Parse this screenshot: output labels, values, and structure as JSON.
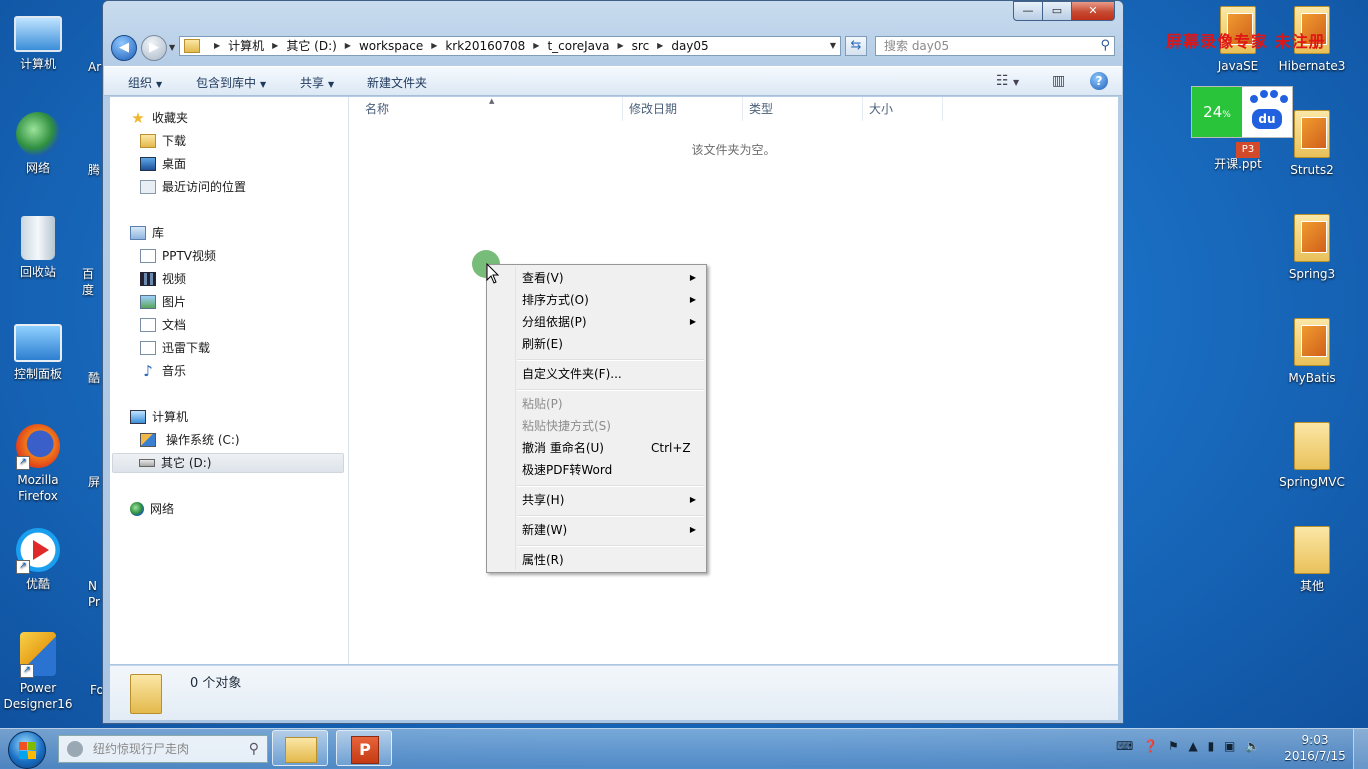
{
  "watermark": "屏幕录像专家 未注册",
  "desktop_left": [
    {
      "label": "计算机",
      "icon": "computer-icon"
    },
    {
      "label": "网络",
      "icon": "network-icon"
    },
    {
      "label": "回收站",
      "icon": "recycle-bin-icon"
    },
    {
      "label": "控制面板",
      "icon": "control-panel-icon"
    },
    {
      "label": "Mozilla Firefox",
      "icon": "firefox-icon"
    },
    {
      "label": "优酷",
      "icon": "youku-icon"
    },
    {
      "label": "Power Designer16",
      "icon": "powerdesigner-icon"
    }
  ],
  "desktop_left_partial": [
    "Ar",
    "腾",
    "百度",
    "酷",
    "屏",
    "N Pr",
    "Fo"
  ],
  "desktop_right": [
    {
      "label": "JavaSE"
    },
    {
      "label": "Hibernate3"
    },
    {
      "label": "开课.ppt"
    },
    {
      "label": "Struts2"
    },
    {
      "label": "Spring3"
    },
    {
      "label": "MyBatis"
    },
    {
      "label": "SpringMVC"
    },
    {
      "label": "其他"
    }
  ],
  "baidu_widget": {
    "percent": "24",
    "percent_unit": "%",
    "logo_text": "du"
  },
  "window": {
    "caption_buttons": {
      "minimize": "—",
      "maximize": "▭",
      "close": "✕"
    },
    "address": {
      "segments": [
        "计算机",
        "其它 (D:)",
        "workspace",
        "krk20160708",
        "t_coreJava",
        "src",
        "day05"
      ]
    },
    "search_placeholder": "搜索 day05",
    "commands": [
      "组织",
      "包含到库中",
      "共享",
      "新建文件夹"
    ],
    "nav": {
      "favorites_header": "收藏夹",
      "favorites": [
        "下载",
        "桌面",
        "最近访问的位置"
      ],
      "libraries_header": "库",
      "libraries": [
        "PPTV视频",
        "视频",
        "图片",
        "文档",
        "迅雷下载",
        "音乐"
      ],
      "computer_header": "计算机",
      "drives": [
        "操作系统 (C:)",
        "其它 (D:)"
      ],
      "network_header": "网络"
    },
    "columns": [
      "名称",
      "修改日期",
      "类型",
      "大小"
    ],
    "empty_message": "该文件夹为空。",
    "status": "0 个对象"
  },
  "context_menu": {
    "items": [
      {
        "label": "查看(V)",
        "submenu": true,
        "disabled": false
      },
      {
        "label": "排序方式(O)",
        "submenu": true,
        "disabled": false
      },
      {
        "label": "分组依据(P)",
        "submenu": true,
        "disabled": false
      },
      {
        "label": "刷新(E)",
        "submenu": false,
        "disabled": false
      },
      {
        "label": "自定义文件夹(F)...",
        "submenu": false,
        "disabled": false
      },
      {
        "label": "粘贴(P)",
        "submenu": false,
        "disabled": true
      },
      {
        "label": "粘贴快捷方式(S)",
        "submenu": false,
        "disabled": true
      },
      {
        "label": "撤消 重命名(U)",
        "shortcut": "Ctrl+Z",
        "submenu": false,
        "disabled": false
      },
      {
        "label": "极速PDF转Word",
        "submenu": false,
        "disabled": false
      },
      {
        "label": "共享(H)",
        "submenu": true,
        "disabled": false
      },
      {
        "label": "新建(W)",
        "submenu": true,
        "disabled": false
      },
      {
        "label": "属性(R)",
        "submenu": false,
        "disabled": false
      }
    ]
  },
  "taskbar": {
    "search_placeholder": "纽约惊现行尸走肉",
    "clock_time": "9:03",
    "clock_date": "2016/7/15"
  }
}
